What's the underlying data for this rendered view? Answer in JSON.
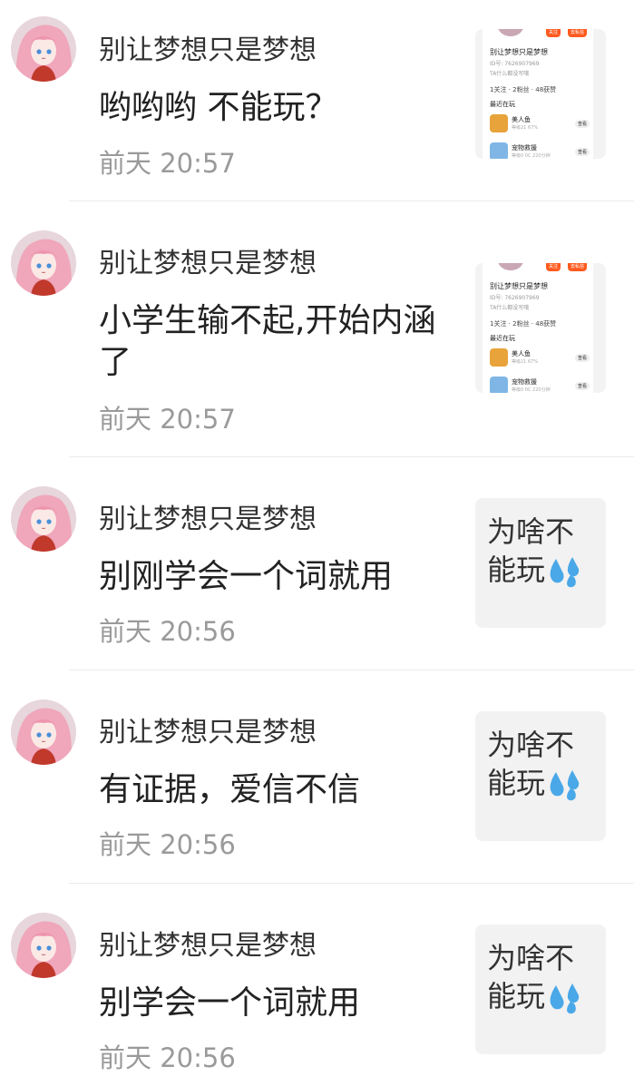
{
  "comments": [
    {
      "username": "别让梦想只是梦想",
      "message": "哟哟哟  不能玩？",
      "time": "前天 20:57",
      "thumbnail": {
        "kind": "screenshot",
        "profile_name": "别让梦想只是梦想",
        "profile_id": "ID号: 7626907969",
        "tagline": "TA什么都没写哦",
        "stats": "1关注 · 2粉丝 · 48获赞",
        "recent_label": "最近在玩",
        "badges": [
          "关注",
          "去私信"
        ],
        "games": [
          {
            "name": "美人鱼",
            "detail": "等级21 67%",
            "button": "查看"
          },
          {
            "name": "宠物救援",
            "detail": "等级0 0C 220分钟",
            "button": "查看"
          }
        ]
      }
    },
    {
      "username": "别让梦想只是梦想",
      "message": "小学生输不起,开始内涵了",
      "time": "前天 20:57",
      "thumbnail": {
        "kind": "screenshot",
        "profile_name": "别让梦想只是梦想",
        "profile_id": "ID号: 7626907969",
        "tagline": "TA什么都没写哦",
        "stats": "1关注 · 2粉丝 · 48获赞",
        "recent_label": "最近在玩",
        "badges": [
          "关注",
          "去私信"
        ],
        "games": [
          {
            "name": "美人鱼",
            "detail": "等级21 67%",
            "button": "查看"
          },
          {
            "name": "宠物救援",
            "detail": "等级0 0C 220分钟",
            "button": "查看"
          }
        ]
      }
    },
    {
      "username": "别让梦想只是梦想",
      "message": "别刚学会一个词就用",
      "time": "前天 20:56",
      "thumbnail": {
        "kind": "text",
        "text": "为啥不能玩",
        "emoji": "sweat-droplets-icon"
      }
    },
    {
      "username": "别让梦想只是梦想",
      "message": "有证据，爱信不信",
      "time": "前天 20:56",
      "thumbnail": {
        "kind": "text",
        "text": "为啥不能玩",
        "emoji": "sweat-droplets-icon"
      }
    },
    {
      "username": "别让梦想只是梦想",
      "message": "别学会一个词就用",
      "time": "前天 20:56",
      "thumbnail": {
        "kind": "text",
        "text": "为啥不能玩",
        "emoji": "sweat-droplets-icon"
      }
    }
  ],
  "colors": {
    "name": "#333333",
    "message": "#222222",
    "time": "#9a9a9a",
    "divider": "#ececec",
    "thumb_bg": "#f2f2f2",
    "badge": "#ff5a1f",
    "drop": "#4aa8e8"
  }
}
